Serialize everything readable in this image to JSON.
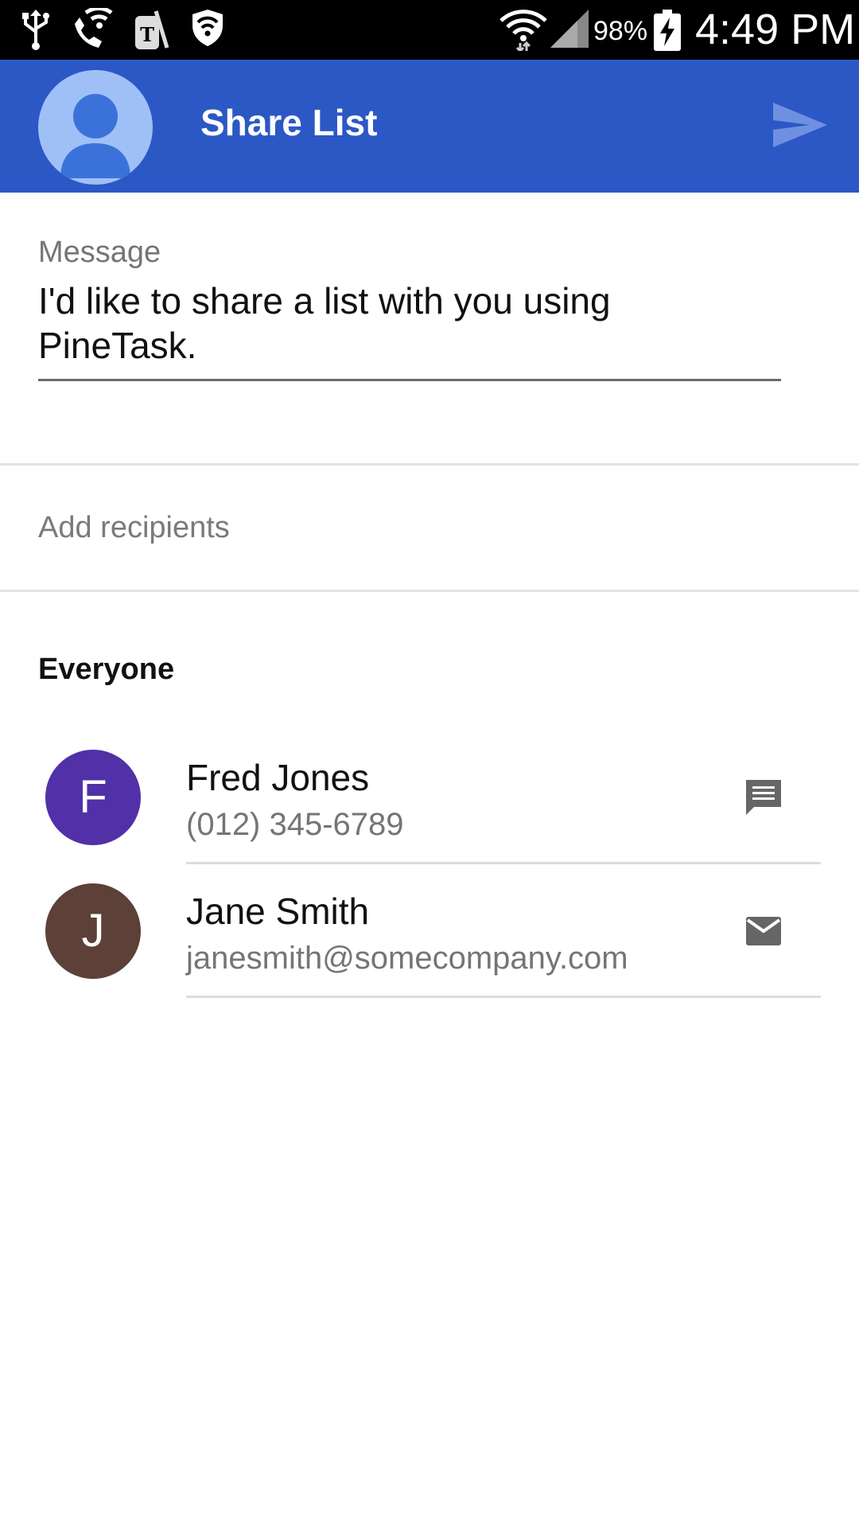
{
  "status_bar": {
    "battery": "98%",
    "time": "4:49 PM"
  },
  "app_bar": {
    "title": "Share List",
    "send_icon": "send-icon",
    "color": "#2c58c6"
  },
  "message": {
    "label": "Message",
    "line1": "I'd like to share a list with you using",
    "line2": "PineTask."
  },
  "recipients": {
    "placeholder": "Add recipients"
  },
  "section": {
    "title": "Everyone"
  },
  "contacts": [
    {
      "initial": "F",
      "name": "Fred Jones",
      "detail": "(012) 345-6789",
      "avatar_color": "#5230a8",
      "action_icon": "message-icon"
    },
    {
      "initial": "J",
      "name": "Jane Smith",
      "detail": "janesmith@somecompany.com",
      "avatar_color": "#5d4037",
      "action_icon": "email-icon"
    }
  ]
}
